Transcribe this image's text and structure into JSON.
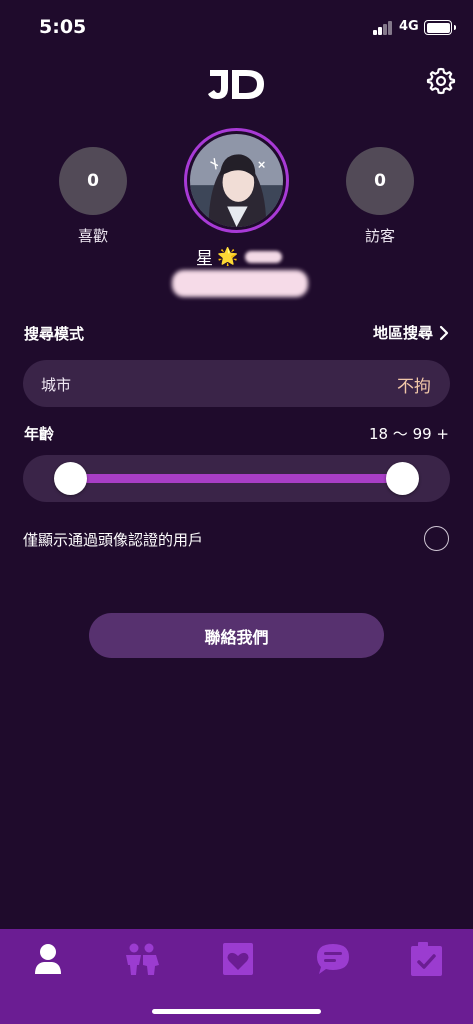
{
  "status_bar": {
    "time": "5:05",
    "network": "4G"
  },
  "header": {
    "logo_text": "JD",
    "settings_icon": "gear-icon"
  },
  "stats": {
    "likes": {
      "count": "0",
      "label": "喜歡"
    },
    "visitors": {
      "count": "0",
      "label": "訪客"
    }
  },
  "profile": {
    "nickname_prefix": "星",
    "nickname_emoji": "🌟"
  },
  "search": {
    "mode_label": "搜尋模式",
    "mode_value": "地區搜尋",
    "city_label": "城市",
    "city_value": "不拘",
    "age_label": "年齡",
    "age_value": "18 ～ 99 +",
    "age_min": 18,
    "age_max": 99
  },
  "verified_only": {
    "label": "僅顯示通過頭像認證的用戶",
    "checked": false
  },
  "contact_button": {
    "label": "聯絡我們"
  },
  "tabbar": {
    "items": [
      {
        "icon": "profile-icon",
        "active": true
      },
      {
        "icon": "couple-icon",
        "active": false
      },
      {
        "icon": "heart-card-icon",
        "active": false
      },
      {
        "icon": "chat-bubble-icon",
        "active": false
      },
      {
        "icon": "checklist-icon",
        "active": false
      }
    ]
  },
  "colors": {
    "background": "#1f0b2c",
    "accent": "#a83ec6",
    "tabbar": "#6b1d93",
    "city_value": "#f1c7a9"
  }
}
